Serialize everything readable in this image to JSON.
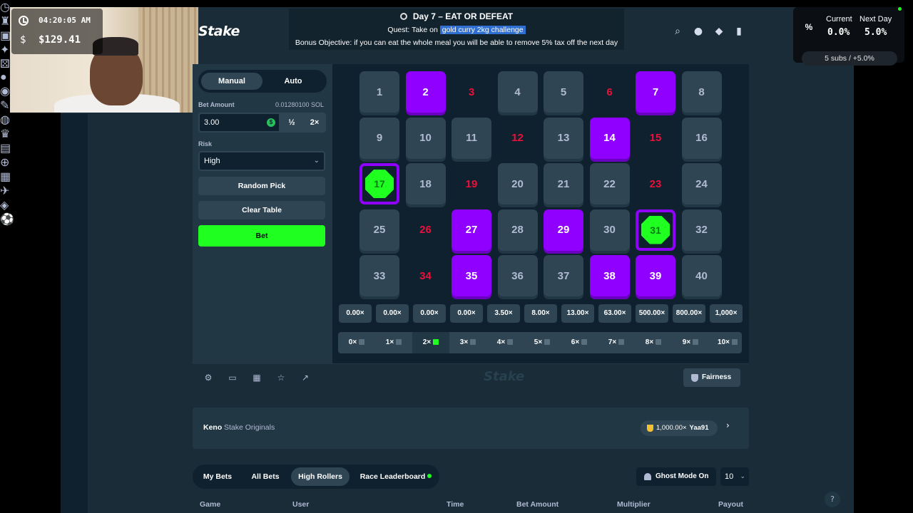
{
  "overlay": {
    "time": "04:20:05 AM",
    "currency": "$",
    "balance": "$129.41",
    "quest_title": "Day 7 – EAT OR DEFEAT",
    "quest_prefix": "Quest: Take on",
    "quest_highlight": "gold curry 2kg challenge",
    "bonus_objective": "Bonus Objective: if you can eat the whole meal you will be able to remove 5% tax off the next day"
  },
  "tax": {
    "icon": "percent-icon",
    "current_label": "Current",
    "current_value": "0.0%",
    "next_label": "Next Day",
    "next_value": "5.0%",
    "subs_text": "5 subs / +5.0%"
  },
  "header": {
    "logo": "Stake",
    "icons": [
      "search-icon",
      "user-icon",
      "notification-icon",
      "sidebar-toggle-icon"
    ]
  },
  "sidebar_icons": [
    "clock-icon",
    "trophy-icon",
    "map-icon",
    "sparkle-icon",
    "dice-icon",
    "fire-icon",
    "basketball-icon",
    "bat-icon",
    "medal-icon",
    "crown-icon",
    "lock-icon",
    "settings-icon",
    "gift-icon",
    "rocket-icon",
    "chart-icon",
    "ball-icon"
  ],
  "controls": {
    "mode_manual": "Manual",
    "mode_auto": "Auto",
    "bet_amount_label": "Bet Amount",
    "bet_amount_conversion": "0.01280100 SOL",
    "bet_amount_value": "3.00",
    "half_label": "½",
    "double_label": "2×",
    "risk_label": "Risk",
    "risk_value": "High",
    "random_pick": "Random Pick",
    "clear_table": "Clear Table",
    "bet": "Bet"
  },
  "board": {
    "numbers": [
      "1",
      "2",
      "3",
      "4",
      "5",
      "6",
      "7",
      "8",
      "9",
      "10",
      "11",
      "12",
      "13",
      "14",
      "15",
      "16",
      "17",
      "18",
      "19",
      "20",
      "21",
      "22",
      "23",
      "24",
      "25",
      "26",
      "27",
      "28",
      "29",
      "30",
      "31",
      "32",
      "33",
      "34",
      "35",
      "36",
      "37",
      "38",
      "39",
      "40"
    ],
    "picked": [
      2,
      7,
      14,
      27,
      29,
      35,
      38,
      39
    ],
    "drawn_misses": [
      3,
      6,
      12,
      15,
      19,
      23,
      26,
      34
    ],
    "hits": [
      17,
      31
    ]
  },
  "payouts": [
    "0.00×",
    "0.00×",
    "0.00×",
    "0.00×",
    "3.50×",
    "8.00×",
    "13.00×",
    "63.00×",
    "500.00×",
    "800.00×",
    "1,000×"
  ],
  "hit_counts": [
    "0×",
    "1×",
    "2×",
    "3×",
    "4×",
    "5×",
    "6×",
    "7×",
    "8×",
    "9×",
    "10×"
  ],
  "active_hit_count": "2×",
  "footer": {
    "watermark": "Stake",
    "fairness": "Fairness",
    "icons": [
      "settings-icon",
      "theatre-mode-icon",
      "stats-icon",
      "favorite-icon",
      "live-stats-icon"
    ]
  },
  "info": {
    "game_name": "Keno",
    "provider": "Stake Originals",
    "record_multiplier": "1,000.00×",
    "record_user": "Yaa91"
  },
  "bets": {
    "tabs": [
      "My Bets",
      "All Bets",
      "High Rollers",
      "Race Leaderboard"
    ],
    "active_tab": "High Rollers",
    "ghost_mode": "Ghost Mode On",
    "count": "10",
    "columns": [
      "Game",
      "User",
      "Time",
      "Bet Amount",
      "Multiplier",
      "Payout"
    ]
  },
  "colors": {
    "picked": "#9000ff",
    "miss_text": "#e9113c",
    "gem": "#1fff20",
    "bg": "#1a2c38"
  }
}
